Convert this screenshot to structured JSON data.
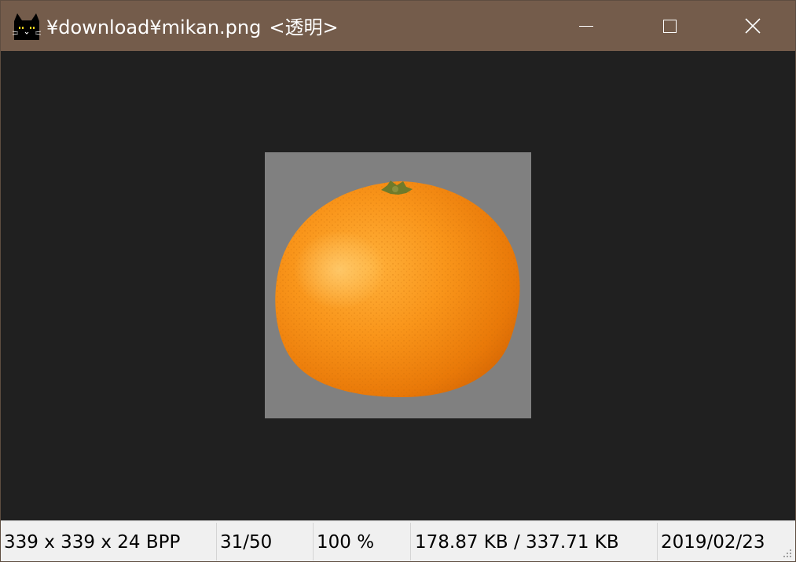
{
  "window": {
    "title_path": "¥download¥mikan.png",
    "title_suffix": "<透明>",
    "app_icon": "black-cat-icon"
  },
  "caption_buttons": {
    "minimize_icon": "minimize-icon",
    "maximize_icon": "maximize-icon",
    "close_icon": "close-icon"
  },
  "image": {
    "subject": "mikan",
    "background_color": "#808080"
  },
  "statusbar": {
    "dimensions": "339 x 339 x 24 BPP",
    "index": "31/50",
    "zoom": "100 %",
    "file_size": "178.87 KB / 337.71 KB",
    "date": "2019/02/23"
  },
  "colors": {
    "titlebar": "#745c4b",
    "viewer_background": "#202020",
    "statusbar": "#f0f0f0",
    "fruit_orange": "#f58a0a"
  }
}
